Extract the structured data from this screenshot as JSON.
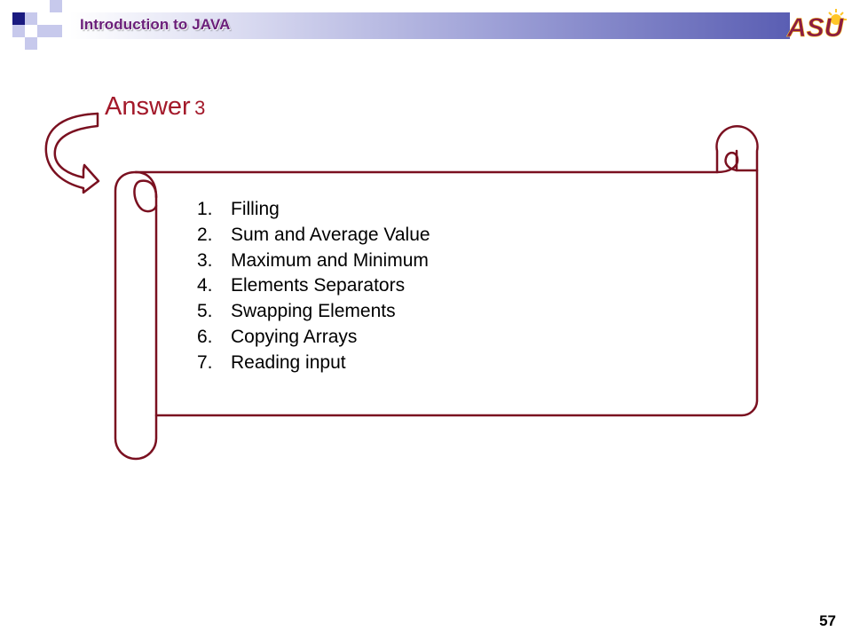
{
  "header": {
    "title": "Introduction to JAVA",
    "logo_text": "ASU"
  },
  "slide": {
    "title_word": "Answer",
    "title_number": "3",
    "items": [
      {
        "number": "1.",
        "text": "Filling"
      },
      {
        "number": "2.",
        "text": "Sum and Average Value"
      },
      {
        "number": "3.",
        "text": "Maximum and Minimum"
      },
      {
        "number": "4.",
        "text": "Elements Separators"
      },
      {
        "number": "5.",
        "text": "Swapping Elements"
      },
      {
        "number": "6.",
        "text": "Copying Arrays"
      },
      {
        "number": "7.",
        "text": "Reading input"
      }
    ]
  },
  "footer": {
    "page_number": "57"
  },
  "colors": {
    "accent": "#a3192a",
    "scroll_outline": "#7a1020",
    "header_title": "#6b1f7a",
    "header_dark_square": "#1a1a80",
    "logo_maroon": "#8c1d40",
    "logo_gold": "#ffc627"
  }
}
